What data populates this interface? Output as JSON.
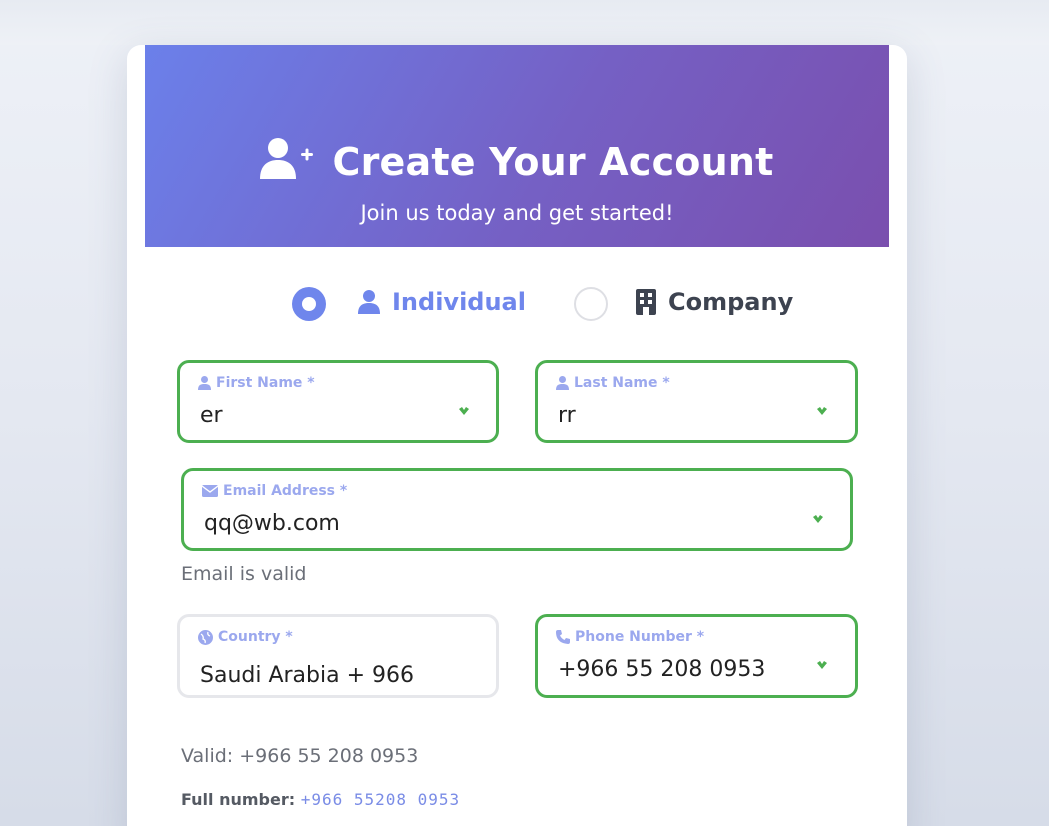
{
  "header": {
    "title": "Create Your Account",
    "subtitle": "Join us today and get started!",
    "icon": "user-plus-icon"
  },
  "account_type": {
    "options": [
      {
        "label": "Individual",
        "icon": "user-icon",
        "selected": true
      },
      {
        "label": "Company",
        "icon": "building-icon",
        "selected": false
      }
    ]
  },
  "form": {
    "first_name": {
      "label": "First Name *",
      "value": "er",
      "valid": true
    },
    "last_name": {
      "label": "Last Name *",
      "value": "rr",
      "valid": true
    },
    "email": {
      "label": "Email Address *",
      "value": "qq@wb.com",
      "valid": true,
      "helper": "Email is valid"
    },
    "country": {
      "label": "Country *",
      "value": "Saudi Arabia + 966"
    },
    "phone": {
      "label": "Phone Number *",
      "value": "+966 55 208 0953",
      "valid": true,
      "helper": "Valid: +966 55 208 0953"
    },
    "full_number": {
      "label": "Full number:",
      "value": "+966  55208  0953"
    }
  },
  "colors": {
    "accent": "#6f86ec",
    "valid": "#4caf50",
    "header_gradient_start": "#6b80ea",
    "header_gradient_end": "#7a4fae"
  }
}
